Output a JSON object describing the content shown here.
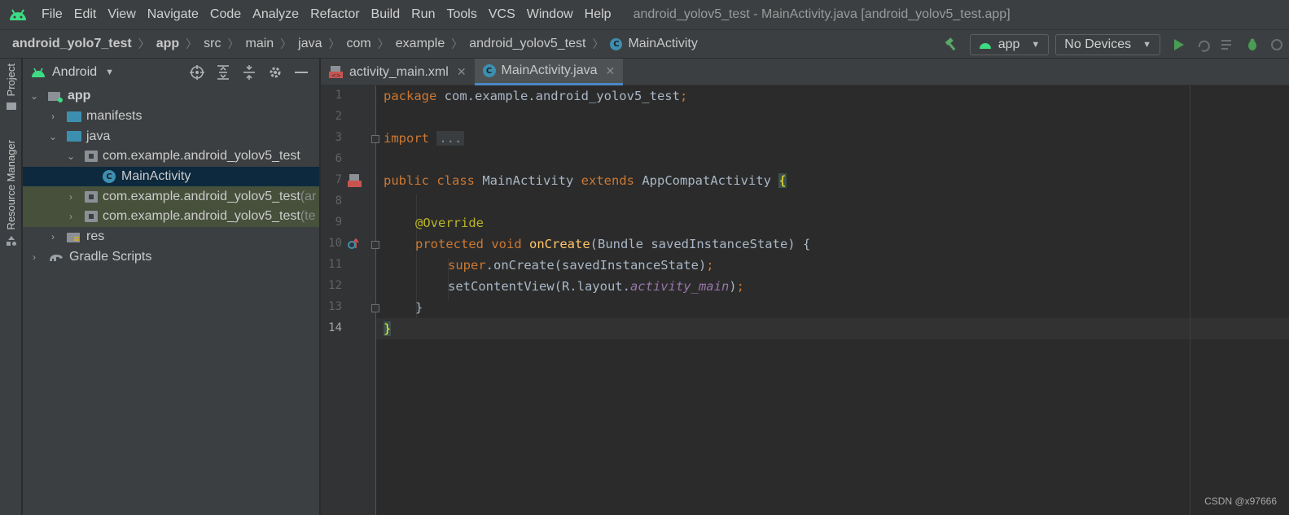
{
  "menu": {
    "items": [
      "File",
      "Edit",
      "View",
      "Navigate",
      "Code",
      "Analyze",
      "Refactor",
      "Build",
      "Run",
      "Tools",
      "VCS",
      "Window",
      "Help"
    ],
    "window_title": "android_yolov5_test - MainActivity.java [android_yolov5_test.app]"
  },
  "breadcrumbs": [
    "android_yolo7_test",
    "app",
    "src",
    "main",
    "java",
    "com",
    "example",
    "android_yolov5_test",
    "MainActivity"
  ],
  "toolbar": {
    "config": "app",
    "device": "No Devices"
  },
  "side_tabs": {
    "project": "Project",
    "resource_manager": "Resource Manager"
  },
  "project_panel": {
    "view": "Android",
    "tree": [
      {
        "label": "app",
        "suffix": ""
      },
      {
        "label": "manifests",
        "suffix": ""
      },
      {
        "label": "java",
        "suffix": ""
      },
      {
        "label": "com.example.android_yolov5_test",
        "suffix": ""
      },
      {
        "label": "MainActivity",
        "suffix": ""
      },
      {
        "label": "com.example.android_yolov5_test",
        "suffix": " (ar"
      },
      {
        "label": "com.example.android_yolov5_test",
        "suffix": " (te"
      },
      {
        "label": "res",
        "suffix": ""
      },
      {
        "label": "Gradle Scripts",
        "suffix": ""
      }
    ]
  },
  "tabs": [
    {
      "label": "activity_main.xml",
      "active": false
    },
    {
      "label": "MainActivity.java",
      "active": true
    }
  ],
  "editor": {
    "line_numbers": [
      "1",
      "2",
      "3",
      "6",
      "7",
      "8",
      "9",
      "10",
      "11",
      "12",
      "13",
      "14"
    ],
    "lines": {
      "l1_kw": "package",
      "l1_rest": " com.example.android_yolov5_test",
      "l1_semi": ";",
      "l3_kw": "import",
      "l3_fold": "...",
      "l7_kw1": "public",
      "l7_kw2": "class",
      "l7_name": " MainActivity ",
      "l7_kw3": "extends",
      "l7_super": " AppCompatActivity ",
      "l7_brace": "{",
      "l9_ann": "@Override",
      "l10_kw1": "protected",
      "l10_kw2": "void",
      "l10_fn": "onCreate",
      "l10_rest": "(Bundle savedInstanceState) {",
      "l11_kw": "super",
      "l11_rest": ".onCreate(savedInstanceState)",
      "l11_semi": ";",
      "l12_rest": "setContentView(R.layout.",
      "l12_it": "activity_main",
      "l12_end": ")",
      "l12_semi": ";",
      "l13": "}",
      "l14": "}"
    }
  },
  "watermark": "CSDN @x97666",
  "colors": {
    "keyword": "#cc7832",
    "annotation": "#bbb529",
    "function": "#ffc66d",
    "field": "#9876aa",
    "selection": "#0d293e"
  }
}
